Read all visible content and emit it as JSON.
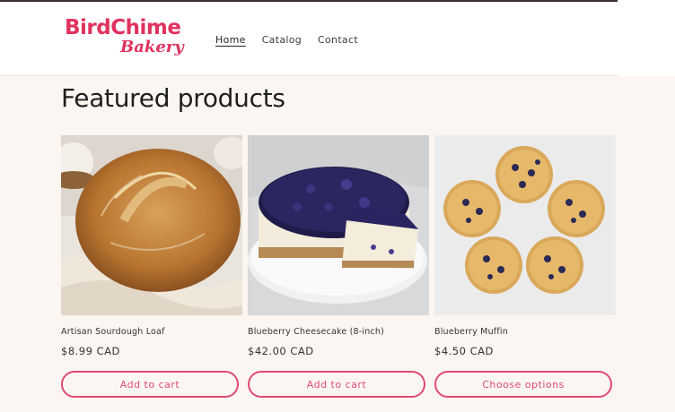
{
  "header": {
    "logo_main": "BirdChime",
    "logo_sub": "Bakery",
    "nav": [
      {
        "label": "Home",
        "active": true
      },
      {
        "label": "Catalog",
        "active": false
      },
      {
        "label": "Contact",
        "active": false
      }
    ]
  },
  "featured": {
    "title": "Featured products",
    "products": [
      {
        "name": "Artisan Sourdough Loaf",
        "price": "$8.99 CAD",
        "button": "Add to cart",
        "image_icon": "sourdough-bread-image"
      },
      {
        "name": "Blueberry Cheesecake (8-inch)",
        "price": "$42.00 CAD",
        "button": "Add to cart",
        "image_icon": "blueberry-cheesecake-image"
      },
      {
        "name": "Blueberry Muffin",
        "price": "$4.50 CAD",
        "button": "Choose options",
        "image_icon": "blueberry-muffins-image"
      }
    ]
  },
  "colors": {
    "accent": "#e0325f",
    "button_border": "#e04a72",
    "page_bg": "#fcf6f2",
    "header_bg": "#ffffff"
  }
}
